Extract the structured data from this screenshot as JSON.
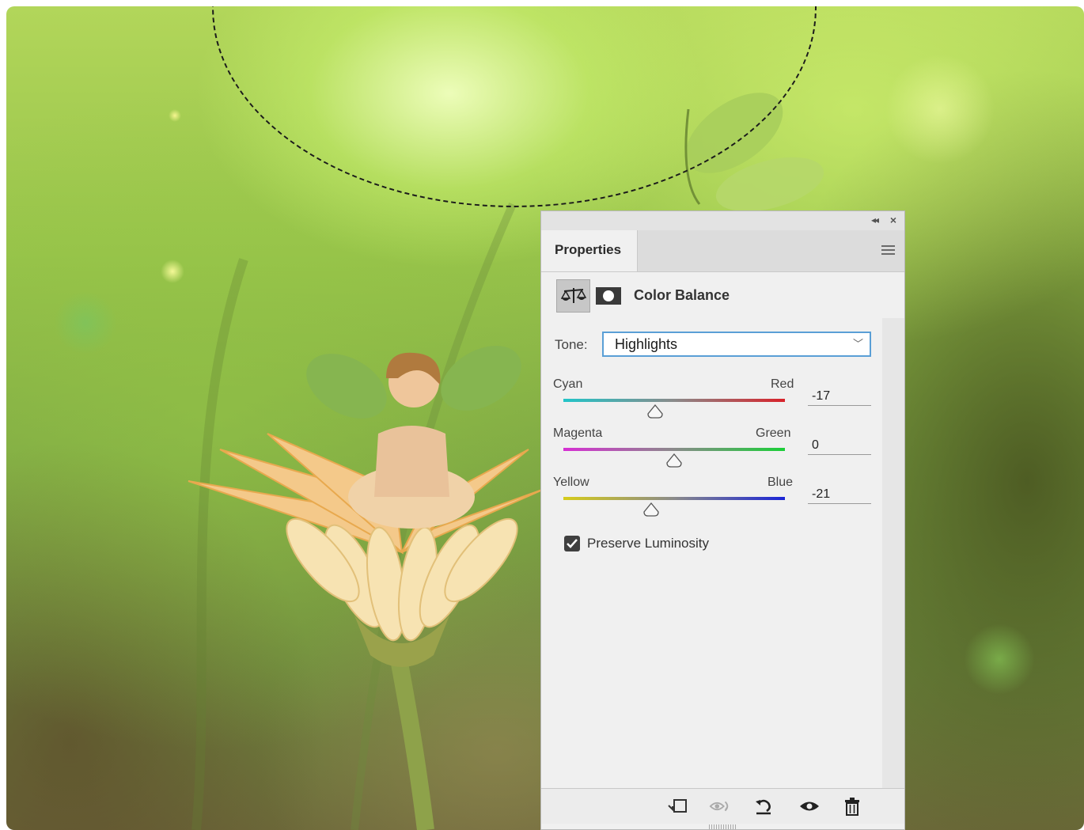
{
  "panel": {
    "tab_label": "Properties",
    "adjustment_title": "Color Balance",
    "tone": {
      "label": "Tone:",
      "selected": "Highlights"
    },
    "sliders": [
      {
        "left_label": "Cyan",
        "right_label": "Red",
        "value": "-17",
        "gradient": [
          "#22c4c8",
          "#d8222a"
        ]
      },
      {
        "left_label": "Magenta",
        "right_label": "Green",
        "value": "0",
        "gradient": [
          "#d62fd3",
          "#1bcf38"
        ]
      },
      {
        "left_label": "Yellow",
        "right_label": "Blue",
        "value": "-21",
        "gradient": [
          "#d6cc1a",
          "#1a24d6"
        ]
      }
    ],
    "preserve_luminosity": {
      "label": "Preserve Luminosity",
      "checked": true
    },
    "footer_icons": [
      "clip-to-layer-icon",
      "view-previous-state-icon",
      "reset-icon",
      "toggle-visibility-icon",
      "delete-icon"
    ]
  },
  "colors": {
    "panel_bg": "#f0f0f0",
    "accent": "#5a9fd6",
    "canvas_green": "#97c34a"
  }
}
